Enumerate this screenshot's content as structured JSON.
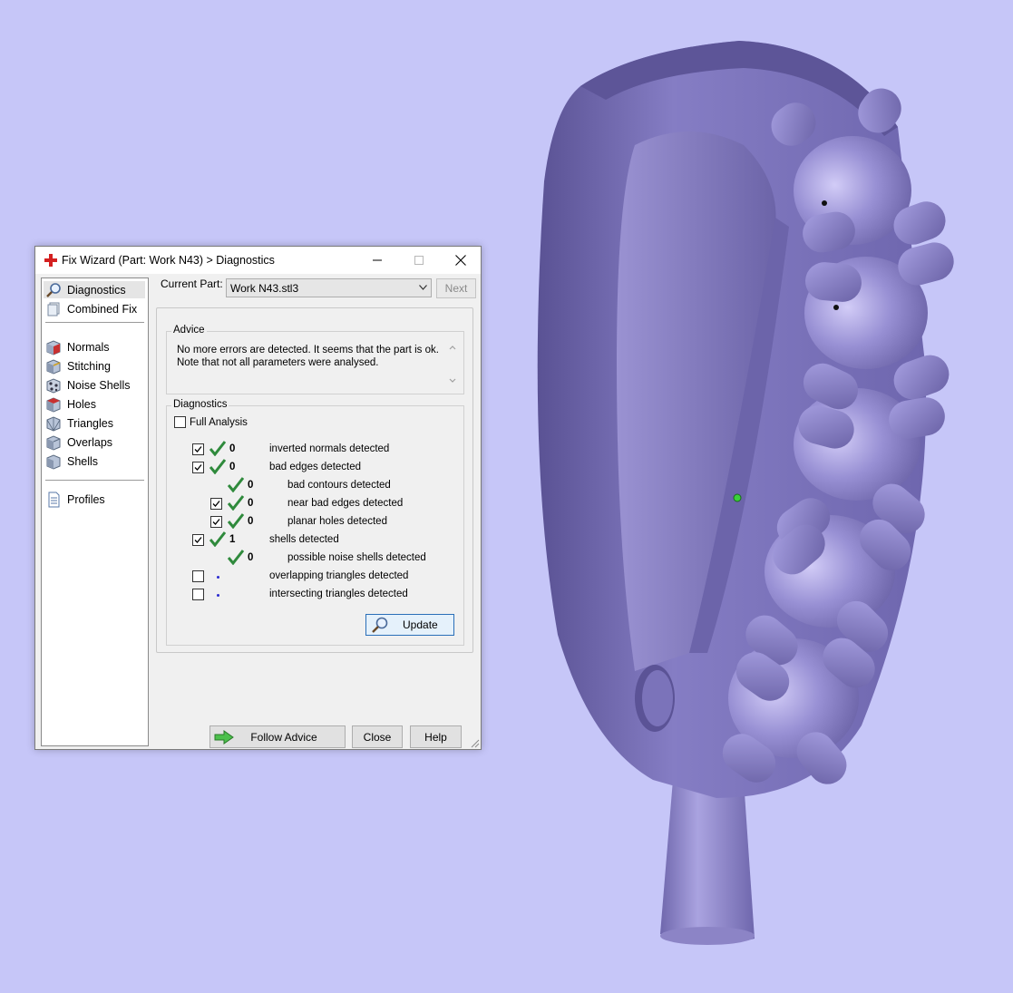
{
  "window": {
    "title": "Fix Wizard (Part: Work N43) > Diagnostics",
    "minimize_glyph": "—",
    "maximize_glyph": "☐",
    "close_glyph": "✕"
  },
  "nav": {
    "items": [
      {
        "label": "Diagnostics",
        "icon": "magnifier-icon"
      },
      {
        "label": "Combined Fix",
        "icon": "combined-fix-icon"
      },
      {
        "label": "Normals",
        "icon": "normals-cube-icon"
      },
      {
        "label": "Stitching",
        "icon": "stitching-cube-icon"
      },
      {
        "label": "Noise Shells",
        "icon": "noise-shells-icon"
      },
      {
        "label": "Holes",
        "icon": "holes-cube-icon"
      },
      {
        "label": "Triangles",
        "icon": "triangles-cube-icon"
      },
      {
        "label": "Overlaps",
        "icon": "overlaps-cube-icon"
      },
      {
        "label": "Shells",
        "icon": "shells-cube-icon"
      },
      {
        "label": "Profiles",
        "icon": "profiles-document-icon"
      }
    ]
  },
  "current_part": {
    "label": "Current Part:",
    "value": "Work N43.stl3",
    "next_label": "Next"
  },
  "advice": {
    "title": "Advice",
    "line1": "No more errors are detected. It seems that the part is ok.",
    "line2": "Note that not all parameters were analysed."
  },
  "diagnostics": {
    "title": "Diagnostics",
    "full_analysis_label": "Full Analysis",
    "full_analysis_checked": false,
    "rows": [
      {
        "count": "0",
        "label": "inverted normals detected",
        "checked": true,
        "status": "ok"
      },
      {
        "count": "0",
        "label": "bad edges detected",
        "checked": true,
        "status": "ok"
      },
      {
        "count": "0",
        "label": "bad contours detected",
        "checked": null,
        "status": "ok"
      },
      {
        "count": "0",
        "label": "near bad edges detected",
        "checked": true,
        "status": "ok"
      },
      {
        "count": "0",
        "label": "planar holes detected",
        "checked": true,
        "status": "ok"
      },
      {
        "count": "1",
        "label": "shells detected",
        "checked": true,
        "status": "ok"
      },
      {
        "count": "0",
        "label": "possible noise shells detected",
        "checked": null,
        "status": "ok"
      },
      {
        "count": "",
        "label": "overlapping triangles detected",
        "checked": false,
        "status": "pending"
      },
      {
        "count": "",
        "label": "intersecting triangles detected",
        "checked": false,
        "status": "pending"
      }
    ],
    "update_label": "Update"
  },
  "footer": {
    "follow_advice_label": "Follow Advice",
    "close_label": "Close",
    "help_label": "Help"
  },
  "colors": {
    "viewport_background": "#c6c6f8",
    "model_purple": "#7a72b8",
    "check_green": "#2f8a3c",
    "title_icon_red": "#d42020"
  }
}
